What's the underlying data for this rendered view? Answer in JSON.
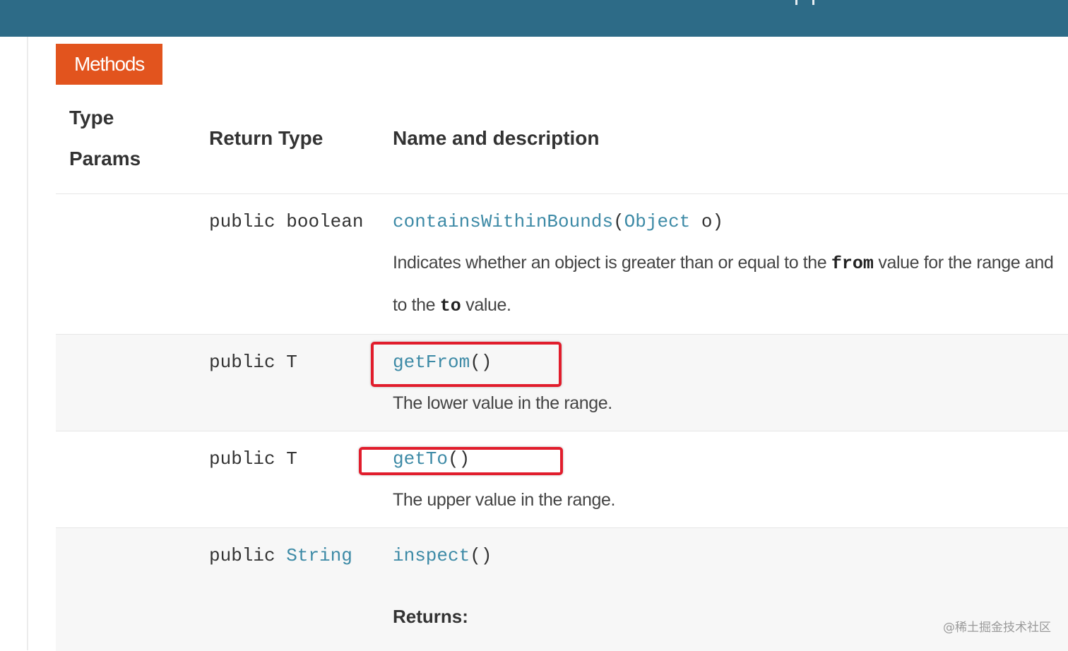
{
  "section_badge": "Methods",
  "columns": {
    "type_params_line1": "Type",
    "type_params_line2": "Params",
    "return_type": "Return Type",
    "name_and_description": "Name and description"
  },
  "methods": [
    {
      "modifier": "public",
      "return_type": "boolean",
      "name": "containsWithinBounds",
      "param_type": "Object",
      "param_name": "o",
      "description_part1": "Indicates whether an object is greater than or equal to the ",
      "description_code1": "from",
      "description_part2": " value for the range and",
      "description_line2_part1": "to the ",
      "description_code2": "to",
      "description_line2_part2": " value."
    },
    {
      "modifier": "public",
      "return_type": "T",
      "name": "getFrom",
      "parens": "()",
      "description": "The lower value in the range."
    },
    {
      "modifier": "public",
      "return_type": "T",
      "name": "getTo",
      "parens": "()",
      "description": "The upper value in the range."
    },
    {
      "modifier": "public",
      "return_type": "String",
      "name": "inspect",
      "parens": "()",
      "returns_label": "Returns:"
    }
  ],
  "watermark": "@稀土掘金技术社区",
  "colors": {
    "header": "#2d6b87",
    "badge": "#e2541e",
    "link": "#3d8aa6",
    "highlight": "#e11d2c"
  }
}
